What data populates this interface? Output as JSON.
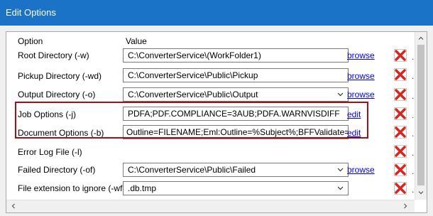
{
  "window": {
    "title": "Edit Options"
  },
  "table": {
    "columns": [
      "Option",
      "Value"
    ],
    "rows": [
      {
        "label": "Root Directory (-w)",
        "value": "C:\\ConverterService\\(WorkFolder1)",
        "type": "text",
        "action": "browse"
      },
      {
        "label": "Pickup Directory (-wd)",
        "value": "C:\\ConverterService\\Public\\Pickup",
        "type": "text",
        "action": "browse"
      },
      {
        "label": "Output Directory (-o)",
        "value": "C:\\ConverterService\\Public\\Output",
        "type": "combo",
        "action": "browse"
      },
      {
        "label": "Job Options (-j)",
        "value": "PDFA;PDF.COMPLIANCE=3AUB;PDFA.WARNVISDIFF",
        "type": "text",
        "action": "edit"
      },
      {
        "label": "Document Options (-b)",
        "value": "Outline=FILENAME;Eml:Outline=%Subject%;BFFValidate=warn",
        "type": "text",
        "action": "edit"
      },
      {
        "label": "Error Log File (-l)",
        "value": "",
        "type": "none",
        "action": ""
      },
      {
        "label": "Failed Directory (-of)",
        "value": "C:\\ConverterService\\Public\\Failed",
        "type": "combo",
        "action": "browse"
      },
      {
        "label": "File extension to ignore (-wfi)",
        "value": ".db.tmp",
        "type": "combo",
        "action": ""
      }
    ],
    "delete_marker": "."
  },
  "colors": {
    "titlebar": "#1a73c6",
    "highlight": "#a80f12",
    "delete_red": "#d8261f",
    "link": "#0000ee"
  },
  "icons": {
    "delete": "red-x-icon",
    "dropdown": "chevron-down-icon"
  }
}
